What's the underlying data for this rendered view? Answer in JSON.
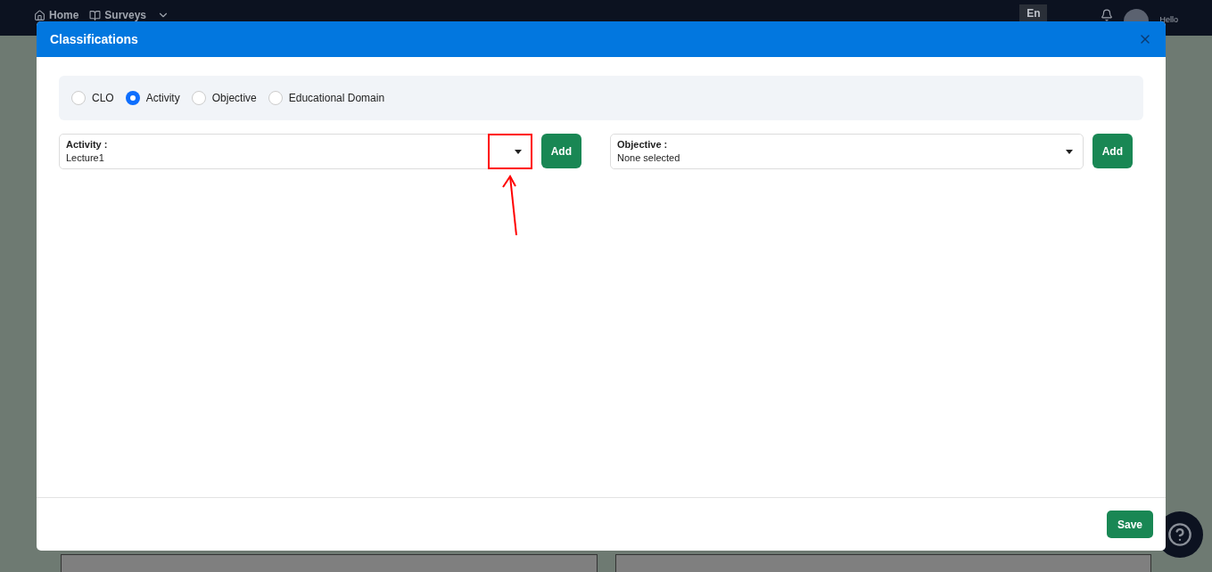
{
  "navbar": {
    "links": [
      {
        "label": "Home"
      },
      {
        "label": "Surveys"
      }
    ],
    "language": "En",
    "greeting": "Hello"
  },
  "modal": {
    "title": "Classifications",
    "options": [
      {
        "label": "CLO",
        "selected": false
      },
      {
        "label": "Activity",
        "selected": true
      },
      {
        "label": "Objective",
        "selected": false
      },
      {
        "label": "Educational Domain",
        "selected": false
      }
    ],
    "selects": [
      {
        "label": "Activity :",
        "value": "Lecture1",
        "button": "Add",
        "highlighted": true
      },
      {
        "label": "Objective :",
        "value": "None selected",
        "button": "Add",
        "highlighted": false
      }
    ],
    "save": "Save"
  }
}
